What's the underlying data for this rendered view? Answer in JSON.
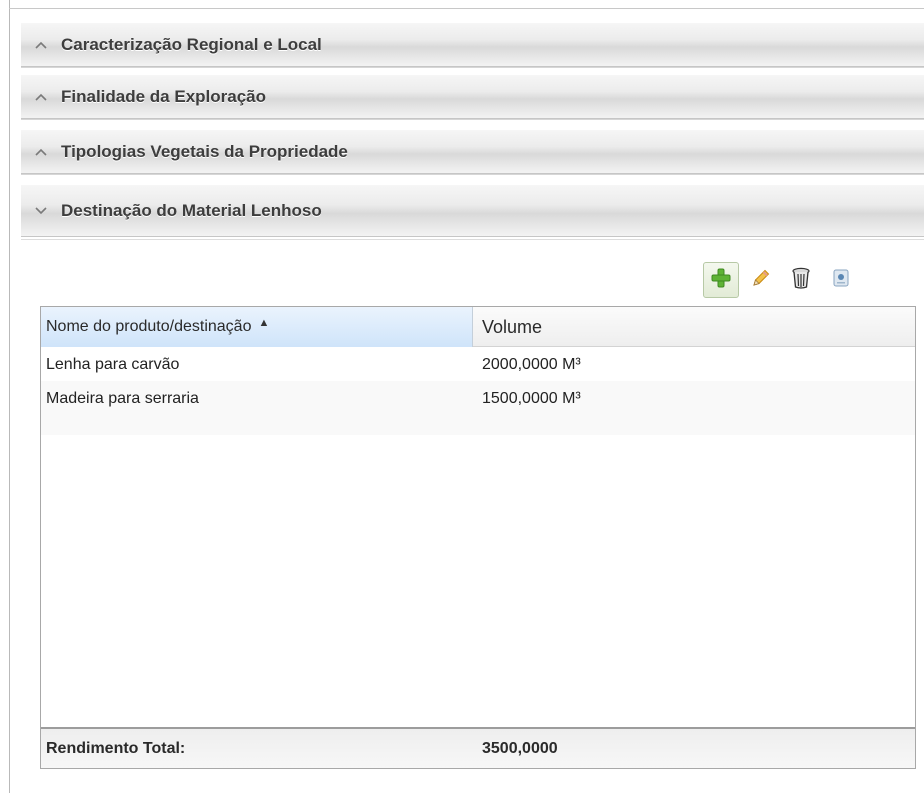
{
  "accordion": {
    "sections": [
      {
        "label": "Caracterização Regional e Local",
        "state": "collapsed"
      },
      {
        "label": "Finalidade da Exploração",
        "state": "collapsed"
      },
      {
        "label": "Tipologias Vegetais da Propriedade",
        "state": "collapsed"
      },
      {
        "label": "Destinação do Material Lenhoso",
        "state": "expanded"
      }
    ]
  },
  "toolbar": {
    "buttons": [
      {
        "icon": "add-icon",
        "color": "#5fb336"
      },
      {
        "icon": "edit-pencil-icon",
        "color": "#e8a421"
      },
      {
        "icon": "trash-can-icon",
        "color": "#444444"
      },
      {
        "icon": "view-details-icon",
        "color": "#6e93b5"
      }
    ]
  },
  "grid": {
    "columns": [
      {
        "label": "Nome do produto/destinação",
        "sort": "ascending"
      },
      {
        "label": "Volume"
      }
    ],
    "rows": [
      {
        "name": "Lenha para carvão",
        "volume": "2000,0000 M³"
      },
      {
        "name": "Madeira para serraria",
        "volume": "1500,0000 M³"
      }
    ],
    "footer": {
      "label": "Rendimento Total:",
      "value": "3500,0000"
    }
  },
  "colors": {
    "header_highlight": "#cfe4fa",
    "accordion_text": "#3d3d3d"
  }
}
